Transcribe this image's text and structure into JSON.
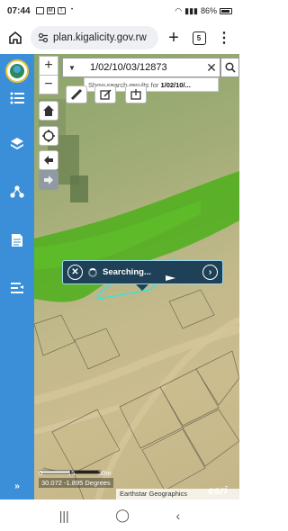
{
  "status_bar": {
    "time": "07:44",
    "battery": "86%"
  },
  "browser": {
    "url": "plan.kigalicity.gov.rw",
    "tab_count": "5"
  },
  "map": {
    "search": {
      "value": "1/02/10/03/12873",
      "suggestion_prefix": "Show search results for ",
      "suggestion_term": "1/02/10/..."
    },
    "popup": {
      "title": "Searching..."
    },
    "scale": {
      "label_0": "0",
      "label_15": "15",
      "label_30": "30m"
    },
    "coordinates": "30.072 -1.895 Degrees",
    "attribution": "Earthstar Geographics",
    "esri_logo_text": "esri"
  },
  "colors": {
    "sidebar": "#3a8fd8",
    "popup_bg": "#1f4158",
    "vegetation": "#4caf1a"
  }
}
